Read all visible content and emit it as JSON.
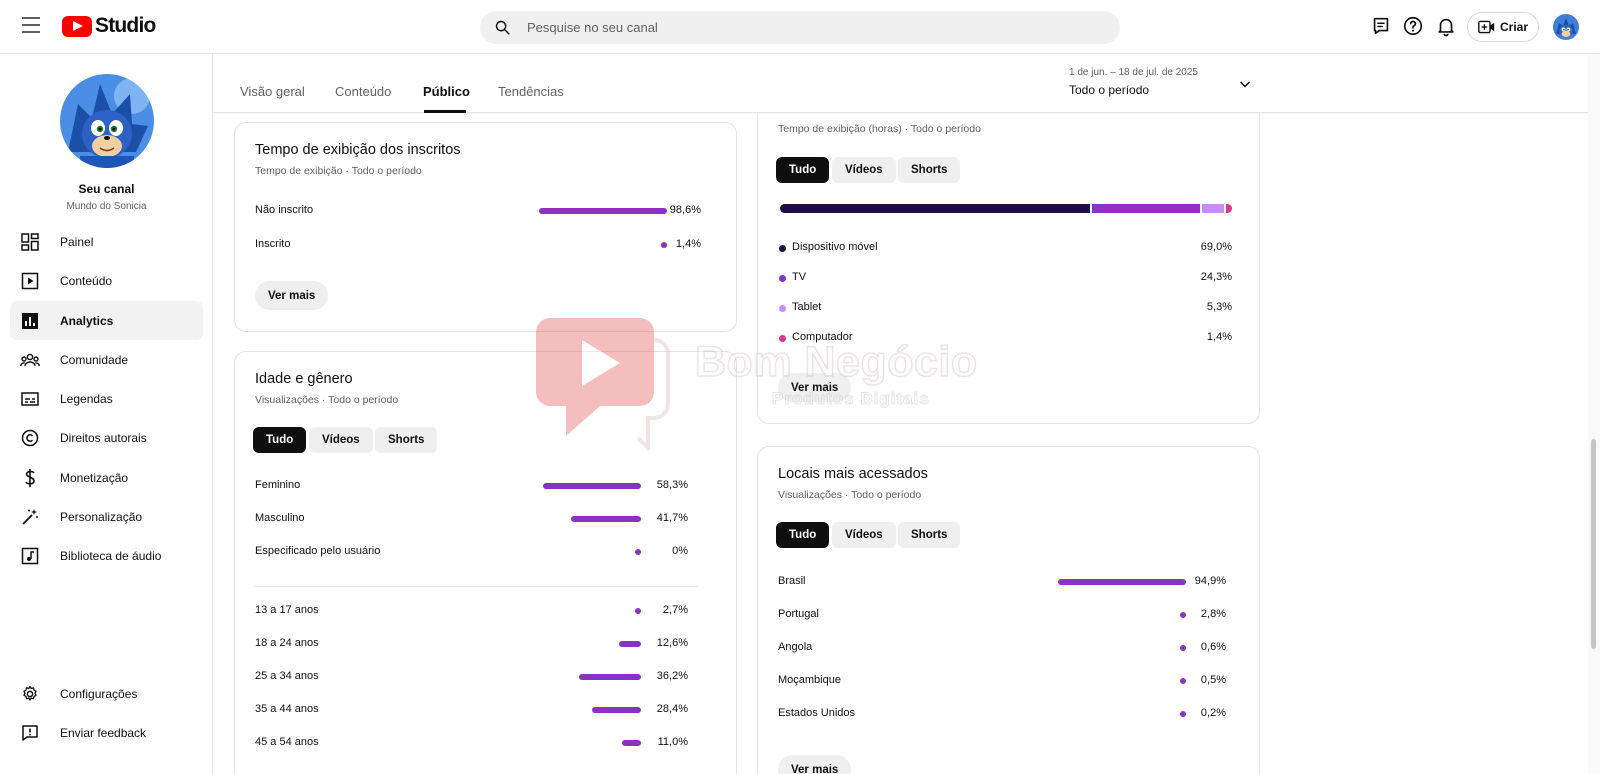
{
  "brand": {
    "name": "Studio"
  },
  "search": {
    "placeholder": "Pesquise no seu canal"
  },
  "topbar": {
    "create_label": "Criar"
  },
  "channel": {
    "name": "Seu canal",
    "subtitle": "Mundo do Sonicia"
  },
  "sidebar": {
    "items": [
      {
        "label": "Painel",
        "icon": "dashboard-icon"
      },
      {
        "label": "Conteúdo",
        "icon": "content-icon"
      },
      {
        "label": "Analytics",
        "icon": "analytics-icon",
        "active": true
      },
      {
        "label": "Comunidade",
        "icon": "community-icon"
      },
      {
        "label": "Legendas",
        "icon": "subtitles-icon"
      },
      {
        "label": "Direitos autorais",
        "icon": "copyright-icon"
      },
      {
        "label": "Monetização",
        "icon": "monetization-icon"
      },
      {
        "label": "Personalização",
        "icon": "customization-icon"
      },
      {
        "label": "Biblioteca de áudio",
        "icon": "audio-library-icon"
      }
    ],
    "bottom": [
      {
        "label": "Configurações",
        "icon": "settings-icon"
      },
      {
        "label": "Enviar feedback",
        "icon": "feedback-icon"
      }
    ]
  },
  "tabs": [
    {
      "label": "Visão geral"
    },
    {
      "label": "Conteúdo"
    },
    {
      "label": "Público",
      "active": true
    },
    {
      "label": "Tendências"
    }
  ],
  "date": {
    "range": "1 de jun. – 18 de jul. de 2025",
    "period": "Todo o período"
  },
  "filters": {
    "all": "Tudo",
    "videos": "Vídeos",
    "shorts": "Shorts",
    "active": "Tudo"
  },
  "see_more_label": "Ver mais",
  "watermark": {
    "title": "Bom Negócio",
    "subtitle": "Produtos Digitais"
  },
  "subscriber_watch": {
    "title": "Tempo de exibição dos inscritos",
    "subtitle": "Tempo de exibição · Todo o período",
    "rows": [
      {
        "label": "Não inscrito",
        "value": "98,6%",
        "pct": 98.6
      },
      {
        "label": "Inscrito",
        "value": "1,4%",
        "pct": 1.4
      }
    ]
  },
  "age_gender": {
    "title": "Idade e gênero",
    "subtitle": "Visualizações · Todo o período",
    "gender": [
      {
        "label": "Feminino",
        "value": "58,3%",
        "pct": 58.3
      },
      {
        "label": "Masculino",
        "value": "41,7%",
        "pct": 41.7
      },
      {
        "label": "Especificado pelo usuário",
        "value": "0%",
        "pct": 0
      }
    ],
    "ages": [
      {
        "label": "13 a 17 anos",
        "value": "2,7%",
        "pct": 2.7
      },
      {
        "label": "18 a 24 anos",
        "value": "12,6%",
        "pct": 12.6
      },
      {
        "label": "25 a 34 anos",
        "value": "36,2%",
        "pct": 36.2
      },
      {
        "label": "35 a 44 anos",
        "value": "28,4%",
        "pct": 28.4
      },
      {
        "label": "45 a 54 anos",
        "value": "11,0%",
        "pct": 11.0
      }
    ]
  },
  "devices": {
    "subtitle": "Tempo de exibição (horas) · Todo o período",
    "items": [
      {
        "label": "Dispositivo móvel",
        "value": "69,0%",
        "pct": 69.0,
        "color": "#1f0b45"
      },
      {
        "label": "TV",
        "value": "24,3%",
        "pct": 24.3,
        "color": "#8c32c3"
      },
      {
        "label": "Tablet",
        "value": "5,3%",
        "pct": 5.3,
        "color": "#c98cf0"
      },
      {
        "label": "Computador",
        "value": "1,4%",
        "pct": 1.4,
        "color": "#d6388f"
      }
    ]
  },
  "locations": {
    "title": "Locais mais acessados",
    "subtitle": "Visualizações · Todo o período",
    "rows": [
      {
        "label": "Brasil",
        "value": "94,9%",
        "pct": 94.9
      },
      {
        "label": "Portugal",
        "value": "2,8%",
        "pct": 2.8
      },
      {
        "label": "Angola",
        "value": "0,6%",
        "pct": 0.6
      },
      {
        "label": "Moçambique",
        "value": "0,5%",
        "pct": 0.5
      },
      {
        "label": "Estados Unidos",
        "value": "0,2%",
        "pct": 0.2
      }
    ]
  },
  "colors": {
    "accent": "#8c32c3",
    "brand": "#ff0000"
  }
}
